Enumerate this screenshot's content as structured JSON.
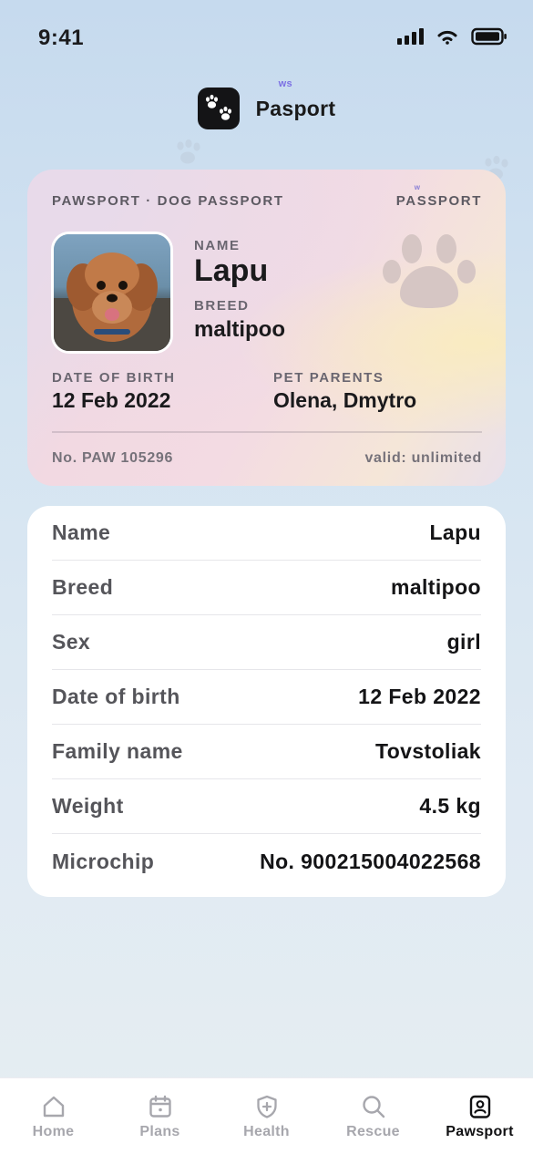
{
  "status_bar": {
    "time": "9:41"
  },
  "brand": {
    "logo_icon": "paw-prints-icon",
    "name": "Pasport",
    "superscript": "ws"
  },
  "passport": {
    "header_left": "PAWSPORT · DOG PASSPORT",
    "header_right": "PASSPORT",
    "header_right_superscript": "w",
    "name_label": "NAME",
    "name_value": "Lapu",
    "breed_label": "BREED",
    "breed_value": "maltipoo",
    "dob_label": "DATE OF BIRTH",
    "dob_value": "12 Feb 2022",
    "parents_label": "PET PARENTS",
    "parents_value": "Olena, Dmytro",
    "number": "No. PAW 105296",
    "validity": "valid: unlimited"
  },
  "details": [
    {
      "label": "Name",
      "value": "Lapu"
    },
    {
      "label": "Breed",
      "value": "maltipoo"
    },
    {
      "label": "Sex",
      "value": "girl"
    },
    {
      "label": "Date of birth",
      "value": "12 Feb 2022"
    },
    {
      "label": "Family name",
      "value": "Tovstoliak"
    },
    {
      "label": "Weight",
      "value": "4.5 kg"
    },
    {
      "label": "Microchip",
      "value": "No. 900215004022568"
    }
  ],
  "tabs": [
    {
      "label": "Home",
      "icon": "home-icon",
      "active": false
    },
    {
      "label": "Plans",
      "icon": "calendar-icon",
      "active": false
    },
    {
      "label": "Health",
      "icon": "shield-plus-icon",
      "active": false
    },
    {
      "label": "Rescue",
      "icon": "search-icon",
      "active": false
    },
    {
      "label": "Pawsport",
      "icon": "id-badge-icon",
      "active": true
    }
  ],
  "colors": {
    "accent": "#7b6fe3",
    "active_tab": "#111113",
    "inactive_tab": "#a7a7ad"
  }
}
